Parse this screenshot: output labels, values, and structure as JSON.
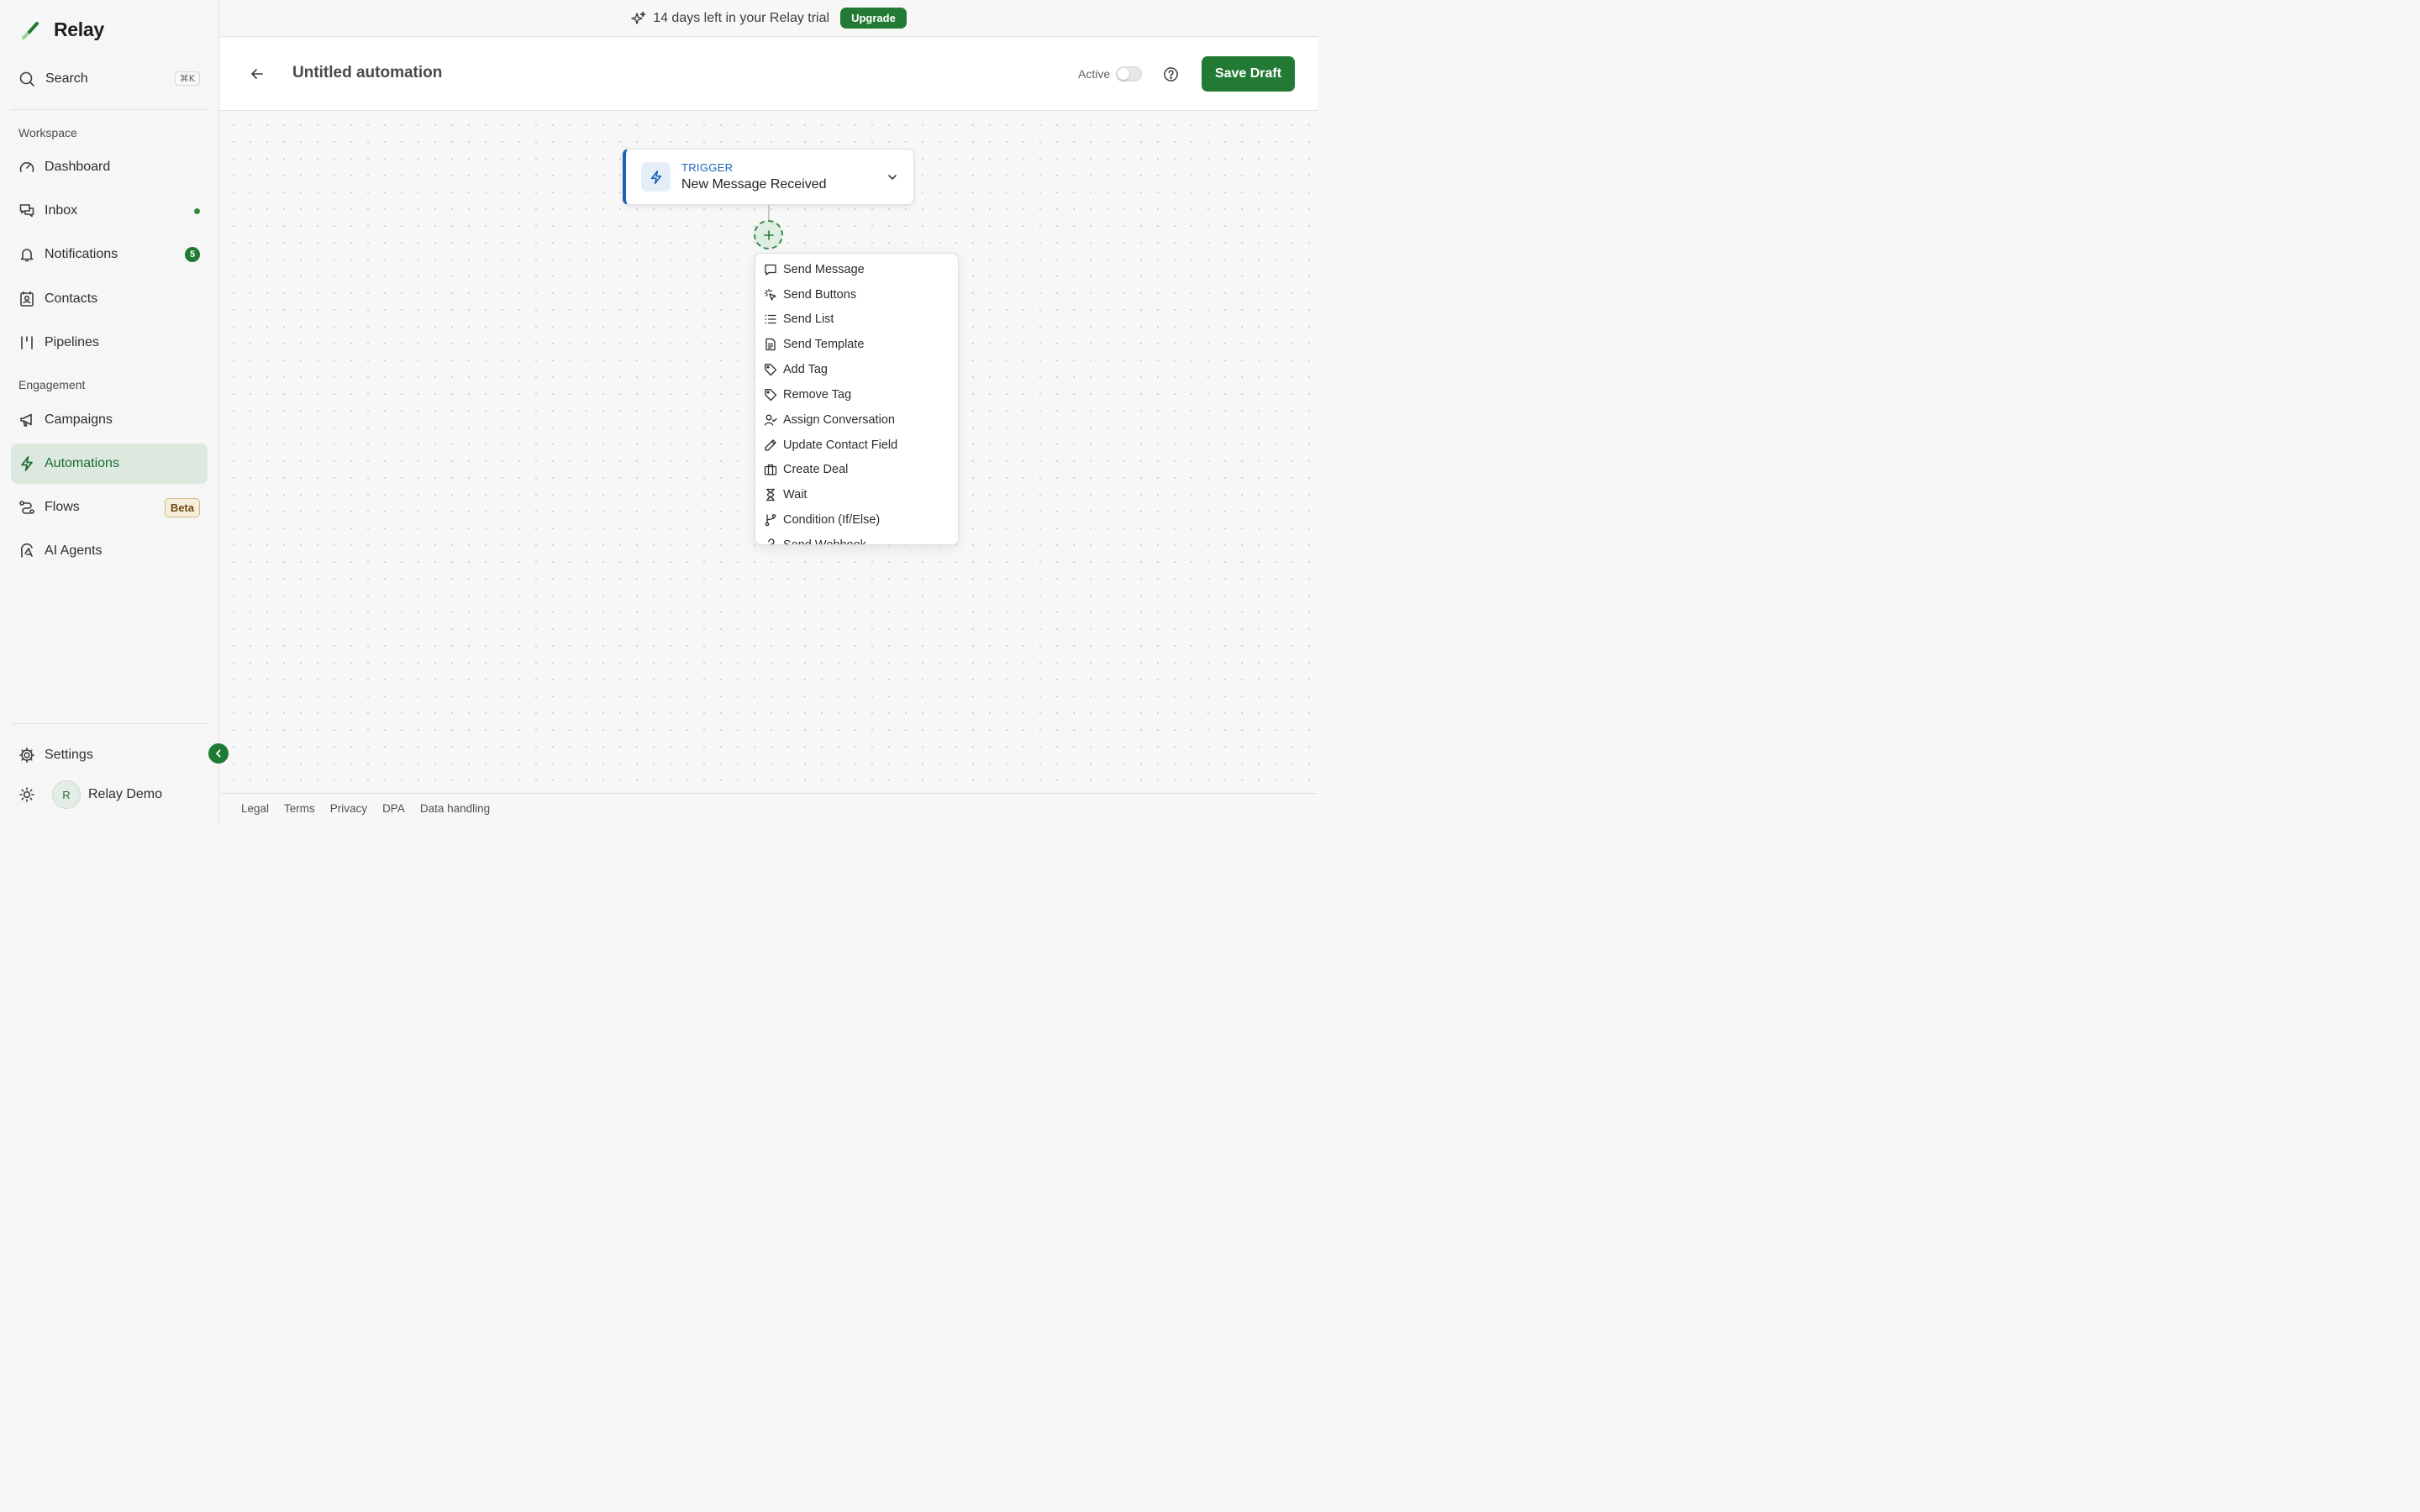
{
  "app": {
    "name": "Relay"
  },
  "search": {
    "label": "Search",
    "shortcut": "⌘K"
  },
  "sidebar": {
    "workspace_label": "Workspace",
    "engagement_label": "Engagement",
    "items": [
      {
        "label": "Dashboard",
        "icon": "gauge-icon"
      },
      {
        "label": "Inbox",
        "icon": "chat-icon",
        "indicator": "dot"
      },
      {
        "label": "Notifications",
        "icon": "bell-icon",
        "badge": "5"
      },
      {
        "label": "Contacts",
        "icon": "contact-book-icon"
      },
      {
        "label": "Pipelines",
        "icon": "pipeline-icon"
      },
      {
        "label": "Campaigns",
        "icon": "megaphone-icon"
      },
      {
        "label": "Automations",
        "icon": "lightning-icon",
        "active": true
      },
      {
        "label": "Flows",
        "icon": "flow-icon",
        "badge": "Beta"
      },
      {
        "label": "AI Agents",
        "icon": "ai-agent-icon"
      }
    ],
    "settings_label": "Settings",
    "user": {
      "initial": "R",
      "name": "Relay Demo"
    }
  },
  "banner": {
    "message": "14 days left in your Relay trial",
    "cta": "Upgrade"
  },
  "header": {
    "title": "Untitled automation",
    "active_label": "Active",
    "active_on": false,
    "save_label": "Save Draft"
  },
  "trigger": {
    "kind": "TRIGGER",
    "name": "New Message Received"
  },
  "action_menu": {
    "items": [
      {
        "label": "Send Message",
        "icon": "message-icon"
      },
      {
        "label": "Send Buttons",
        "icon": "click-icon"
      },
      {
        "label": "Send List",
        "icon": "list-icon"
      },
      {
        "label": "Send Template",
        "icon": "document-icon"
      },
      {
        "label": "Add Tag",
        "icon": "tag-icon"
      },
      {
        "label": "Remove Tag",
        "icon": "tag-icon"
      },
      {
        "label": "Assign Conversation",
        "icon": "user-check-icon"
      },
      {
        "label": "Update Contact Field",
        "icon": "pencil-icon"
      },
      {
        "label": "Create Deal",
        "icon": "briefcase-icon"
      },
      {
        "label": "Wait",
        "icon": "hourglass-icon"
      },
      {
        "label": "Condition (If/Else)",
        "icon": "branch-icon"
      },
      {
        "label": "Send Webhook",
        "icon": "webhook-icon"
      }
    ]
  },
  "footer": {
    "links": [
      "Legal",
      "Terms",
      "Privacy",
      "DPA",
      "Data handling"
    ]
  },
  "colors": {
    "brand": "#237a35",
    "trigger_accent": "#1c63b8",
    "active_nav_bg": "#dde9df"
  }
}
